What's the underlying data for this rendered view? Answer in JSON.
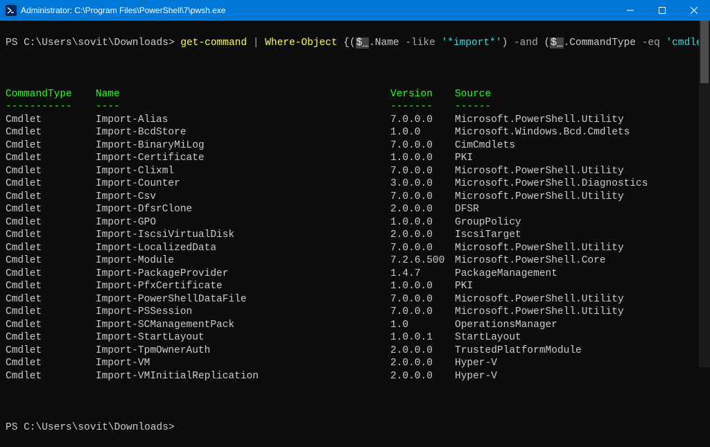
{
  "window": {
    "title": "Administrator: C:\\Program Files\\PowerShell\\7\\pwsh.exe"
  },
  "prompt": {
    "path": "PS C:\\Users\\sovit\\Downloads> ",
    "cmd": {
      "p1": "get-command",
      "pipe": " | ",
      "p2": "Where-Object",
      "sp": " ",
      "brace_open": "{(",
      "var1": "$_",
      "dot1": ".Name ",
      "op1": "-like",
      "sp2": " ",
      "str1": "'*import*'",
      "paren_mid": ") ",
      "op2": "-and",
      "sp3": " (",
      "var2": "$_",
      "dot2": ".CommandType ",
      "op3": "-eq",
      "sp4": " ",
      "str2": "'cmdlet'",
      "brace_close": ")}"
    }
  },
  "headers": {
    "c1": "CommandType",
    "c2": "Name",
    "c3": "Version",
    "c4": "Source"
  },
  "dashes": {
    "c1": "-----------",
    "c2": "----",
    "c3": "-------",
    "c4": "------"
  },
  "rows": [
    {
      "c1": "Cmdlet",
      "c2": "Import-Alias",
      "c3": "7.0.0.0",
      "c4": "Microsoft.PowerShell.Utility"
    },
    {
      "c1": "Cmdlet",
      "c2": "Import-BcdStore",
      "c3": "1.0.0",
      "c4": "Microsoft.Windows.Bcd.Cmdlets"
    },
    {
      "c1": "Cmdlet",
      "c2": "Import-BinaryMiLog",
      "c3": "7.0.0.0",
      "c4": "CimCmdlets"
    },
    {
      "c1": "Cmdlet",
      "c2": "Import-Certificate",
      "c3": "1.0.0.0",
      "c4": "PKI"
    },
    {
      "c1": "Cmdlet",
      "c2": "Import-Clixml",
      "c3": "7.0.0.0",
      "c4": "Microsoft.PowerShell.Utility"
    },
    {
      "c1": "Cmdlet",
      "c2": "Import-Counter",
      "c3": "3.0.0.0",
      "c4": "Microsoft.PowerShell.Diagnostics"
    },
    {
      "c1": "Cmdlet",
      "c2": "Import-Csv",
      "c3": "7.0.0.0",
      "c4": "Microsoft.PowerShell.Utility"
    },
    {
      "c1": "Cmdlet",
      "c2": "Import-DfsrClone",
      "c3": "2.0.0.0",
      "c4": "DFSR"
    },
    {
      "c1": "Cmdlet",
      "c2": "Import-GPO",
      "c3": "1.0.0.0",
      "c4": "GroupPolicy"
    },
    {
      "c1": "Cmdlet",
      "c2": "Import-IscsiVirtualDisk",
      "c3": "2.0.0.0",
      "c4": "IscsiTarget"
    },
    {
      "c1": "Cmdlet",
      "c2": "Import-LocalizedData",
      "c3": "7.0.0.0",
      "c4": "Microsoft.PowerShell.Utility"
    },
    {
      "c1": "Cmdlet",
      "c2": "Import-Module",
      "c3": "7.2.6.500",
      "c4": "Microsoft.PowerShell.Core"
    },
    {
      "c1": "Cmdlet",
      "c2": "Import-PackageProvider",
      "c3": "1.4.7",
      "c4": "PackageManagement"
    },
    {
      "c1": "Cmdlet",
      "c2": "Import-PfxCertificate",
      "c3": "1.0.0.0",
      "c4": "PKI"
    },
    {
      "c1": "Cmdlet",
      "c2": "Import-PowerShellDataFile",
      "c3": "7.0.0.0",
      "c4": "Microsoft.PowerShell.Utility"
    },
    {
      "c1": "Cmdlet",
      "c2": "Import-PSSession",
      "c3": "7.0.0.0",
      "c4": "Microsoft.PowerShell.Utility"
    },
    {
      "c1": "Cmdlet",
      "c2": "Import-SCManagementPack",
      "c3": "1.0",
      "c4": "OperationsManager"
    },
    {
      "c1": "Cmdlet",
      "c2": "Import-StartLayout",
      "c3": "1.0.0.1",
      "c4": "StartLayout"
    },
    {
      "c1": "Cmdlet",
      "c2": "Import-TpmOwnerAuth",
      "c3": "2.0.0.0",
      "c4": "TrustedPlatformModule"
    },
    {
      "c1": "Cmdlet",
      "c2": "Import-VM",
      "c3": "2.0.0.0",
      "c4": "Hyper-V"
    },
    {
      "c1": "Cmdlet",
      "c2": "Import-VMInitialReplication",
      "c3": "2.0.0.0",
      "c4": "Hyper-V"
    }
  ],
  "prompt2": "PS C:\\Users\\sovit\\Downloads> "
}
